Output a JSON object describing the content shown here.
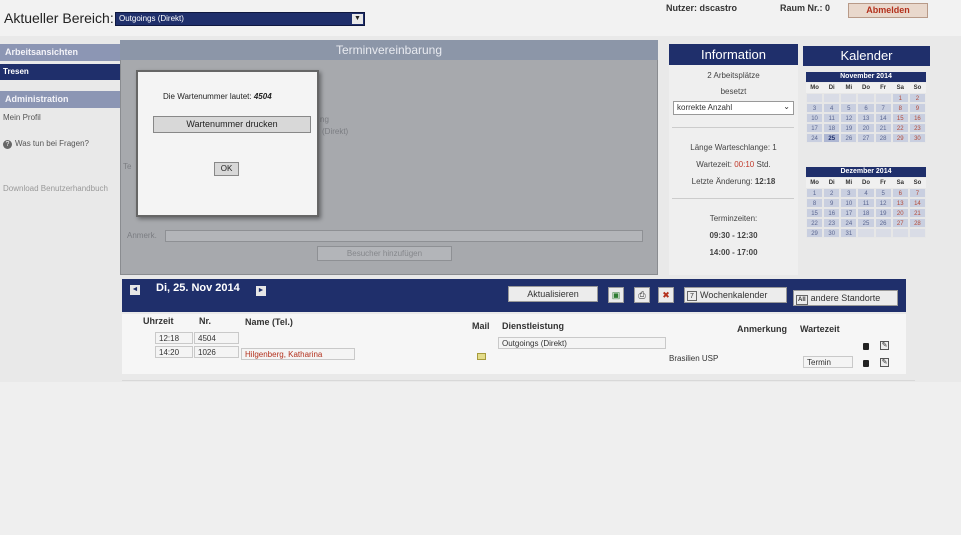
{
  "header": {
    "area_label": "Aktueller Bereich:",
    "area_value": "Outgoings (Direkt)",
    "user": "Nutzer: dscastro",
    "room": "Raum Nr.: 0",
    "logout": "Abmelden"
  },
  "sidebar": {
    "section1": "Arbeitsansichten",
    "item_active": "Tresen",
    "section2": "Administration",
    "profile": "Mein Profil",
    "help": "Was tun bei Fragen?",
    "download": "Download Benutzerhandbuch"
  },
  "termin": {
    "title": "Terminvereinbarung",
    "ghost_ng": "ng",
    "ghost_direkt": "(Direkt)",
    "ghost_te": "Te",
    "remark_label": "Anmerk.",
    "add_button": "Besucher hinzufügen"
  },
  "dialog": {
    "text": "Die Wartenummer lautet:",
    "number": "4504",
    "print_button": "Wartenummer drucken",
    "ok_button": "OK"
  },
  "info": {
    "title": "Information",
    "workplaces_line1": "2 Arbeitsplätze",
    "workplaces_line2": "besetzt",
    "select_value": "korrekte Anzahl",
    "queue": "Länge Warteschlange: 1",
    "wait_label": "Wartezeit:",
    "wait_value": "00:10",
    "wait_unit": "Std.",
    "last_change_label": "Letzte Änderung:",
    "last_change_value": "12:18",
    "hours_title": "Terminzeiten:",
    "hours1": "09:30 - 12:30",
    "hours2": "14:00 - 17:00"
  },
  "calendar": {
    "title": "Kalender",
    "dow": [
      "Mo",
      "Di",
      "Mi",
      "Do",
      "Fr",
      "Sa",
      "So"
    ],
    "nov": {
      "name": "November 2014",
      "cells": [
        "",
        "",
        "",
        "",
        "",
        "1",
        "2",
        "3",
        "4",
        "5",
        "6",
        "7",
        "8",
        "9",
        "10",
        "11",
        "12",
        "13",
        "14",
        "15",
        "16",
        "17",
        "18",
        "19",
        "20",
        "21",
        "22",
        "23",
        "24",
        "25",
        "26",
        "27",
        "28",
        "29",
        "30"
      ],
      "today": "25"
    },
    "dec": {
      "name": "Dezember 2014",
      "cells": [
        "1",
        "2",
        "3",
        "4",
        "5",
        "6",
        "7",
        "8",
        "9",
        "10",
        "11",
        "12",
        "13",
        "14",
        "15",
        "16",
        "17",
        "18",
        "19",
        "20",
        "21",
        "22",
        "23",
        "24",
        "25",
        "26",
        "27",
        "28",
        "29",
        "30",
        "31",
        "",
        "",
        "",
        ""
      ]
    }
  },
  "toolbar": {
    "prev": "◄",
    "date": "Di, 25. Nov 2014",
    "next": "►",
    "refresh": "Aktualisieren",
    "week_num": "7",
    "week_cal": "Wochenkalender",
    "all_badge": "All",
    "other_locations": "andere Standorte"
  },
  "table": {
    "headers": {
      "time": "Uhrzeit",
      "nr": "Nr.",
      "name": "Name (Tel.)",
      "mail": "Mail",
      "service": "Dienstleistung",
      "remark": "Anmerkung",
      "wait": "Wartezeit"
    },
    "rows": [
      {
        "time": "12:18",
        "nr": "4504",
        "name": "",
        "service": "Outgoings (Direkt)",
        "remark": "",
        "wait": ""
      },
      {
        "time": "14:20",
        "nr": "1026",
        "name": "Hilgenberg, Katharina",
        "service": "",
        "remark": "Brasilien USP",
        "wait": "Termin"
      }
    ]
  }
}
